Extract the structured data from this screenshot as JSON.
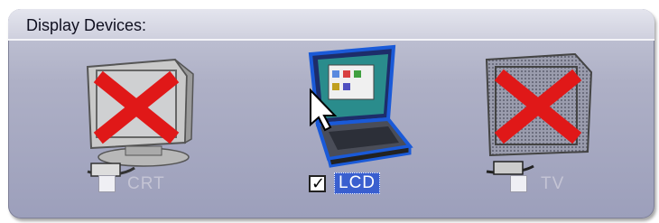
{
  "group_title": "Display Devices:",
  "devices": [
    {
      "label": "CRT",
      "checked": false,
      "available": false,
      "icon": "crt-monitor-disabled-icon"
    },
    {
      "label": "LCD",
      "checked": true,
      "available": true,
      "icon": "laptop-lcd-icon"
    },
    {
      "label": "TV",
      "checked": false,
      "available": false,
      "icon": "tv-disabled-icon"
    }
  ],
  "colors": {
    "panel": "#a8aac2",
    "header": "#d8d9e5",
    "selection": "#3a5fcf",
    "x_mark": "#e01818"
  }
}
